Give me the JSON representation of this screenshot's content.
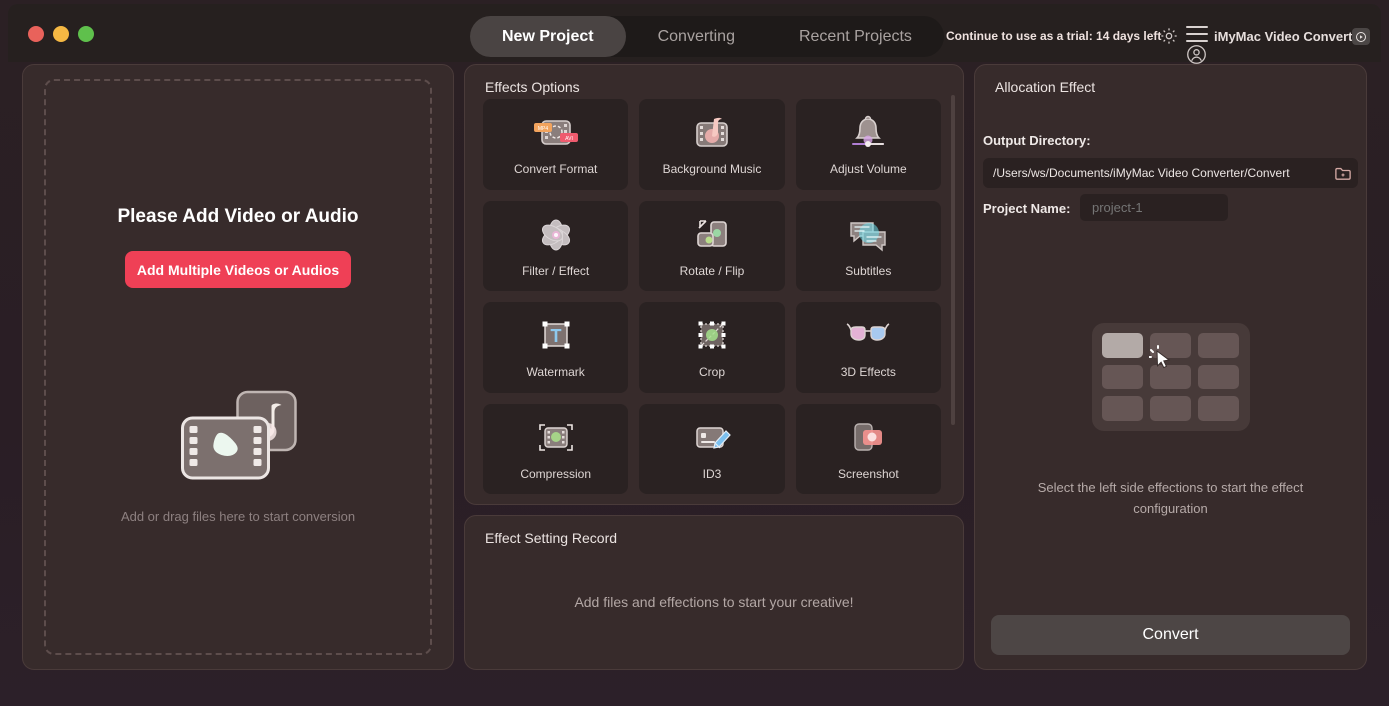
{
  "window": {
    "traffic_lights": [
      "close",
      "minimize",
      "maximize"
    ],
    "colors": {
      "close": "#e9625b",
      "minimize": "#f5b843",
      "maximize": "#5fc04c",
      "accent": "#ef4056",
      "panel": "#372b2b",
      "card": "#2a2222"
    }
  },
  "header": {
    "tabs": [
      {
        "label": "New Project",
        "active": true
      },
      {
        "label": "Converting",
        "active": false
      },
      {
        "label": "Recent Projects",
        "active": false
      }
    ],
    "trial_text": "Continue to use as a trial: 14 days left",
    "brand": "iMyMac Video Converter",
    "icons": [
      "gear-icon",
      "hamburger-menu-icon",
      "account-icon",
      "play-badge-icon"
    ]
  },
  "left_panel": {
    "title": "Please Add Video or Audio",
    "add_button": "Add Multiple Videos or Audios",
    "drag_hint": "Add or drag files here to start conversion"
  },
  "effects": {
    "title": "Effects Options",
    "items": [
      {
        "label": "Convert Format",
        "icon": "convert-format-icon"
      },
      {
        "label": "Background Music",
        "icon": "background-music-icon"
      },
      {
        "label": "Adjust Volume",
        "icon": "adjust-volume-icon"
      },
      {
        "label": "Filter / Effect",
        "icon": "filter-effect-icon"
      },
      {
        "label": "Rotate / Flip",
        "icon": "rotate-flip-icon"
      },
      {
        "label": "Subtitles",
        "icon": "subtitles-icon"
      },
      {
        "label": "Watermark",
        "icon": "watermark-icon"
      },
      {
        "label": "Crop",
        "icon": "crop-icon"
      },
      {
        "label": "3D Effects",
        "icon": "3d-effects-icon"
      },
      {
        "label": "Compression",
        "icon": "compression-icon"
      },
      {
        "label": "ID3",
        "icon": "id3-icon"
      },
      {
        "label": "Screenshot",
        "icon": "screenshot-icon"
      }
    ]
  },
  "record": {
    "title": "Effect Setting Record",
    "empty_message": "Add files and effections to start your creative!"
  },
  "allocation": {
    "title": "Allocation Effect",
    "output_directory_label": "Output Directory:",
    "output_directory_value": "/Users/ws/Documents/iMyMac Video Converter/Convert",
    "project_name_label": "Project Name:",
    "project_name_placeholder": "project-1",
    "project_name_value": "",
    "select_hint": "Select the left side effections to start the effect configuration",
    "convert_button": "Convert",
    "grid_cells": 9,
    "highlighted_cell": 1
  }
}
